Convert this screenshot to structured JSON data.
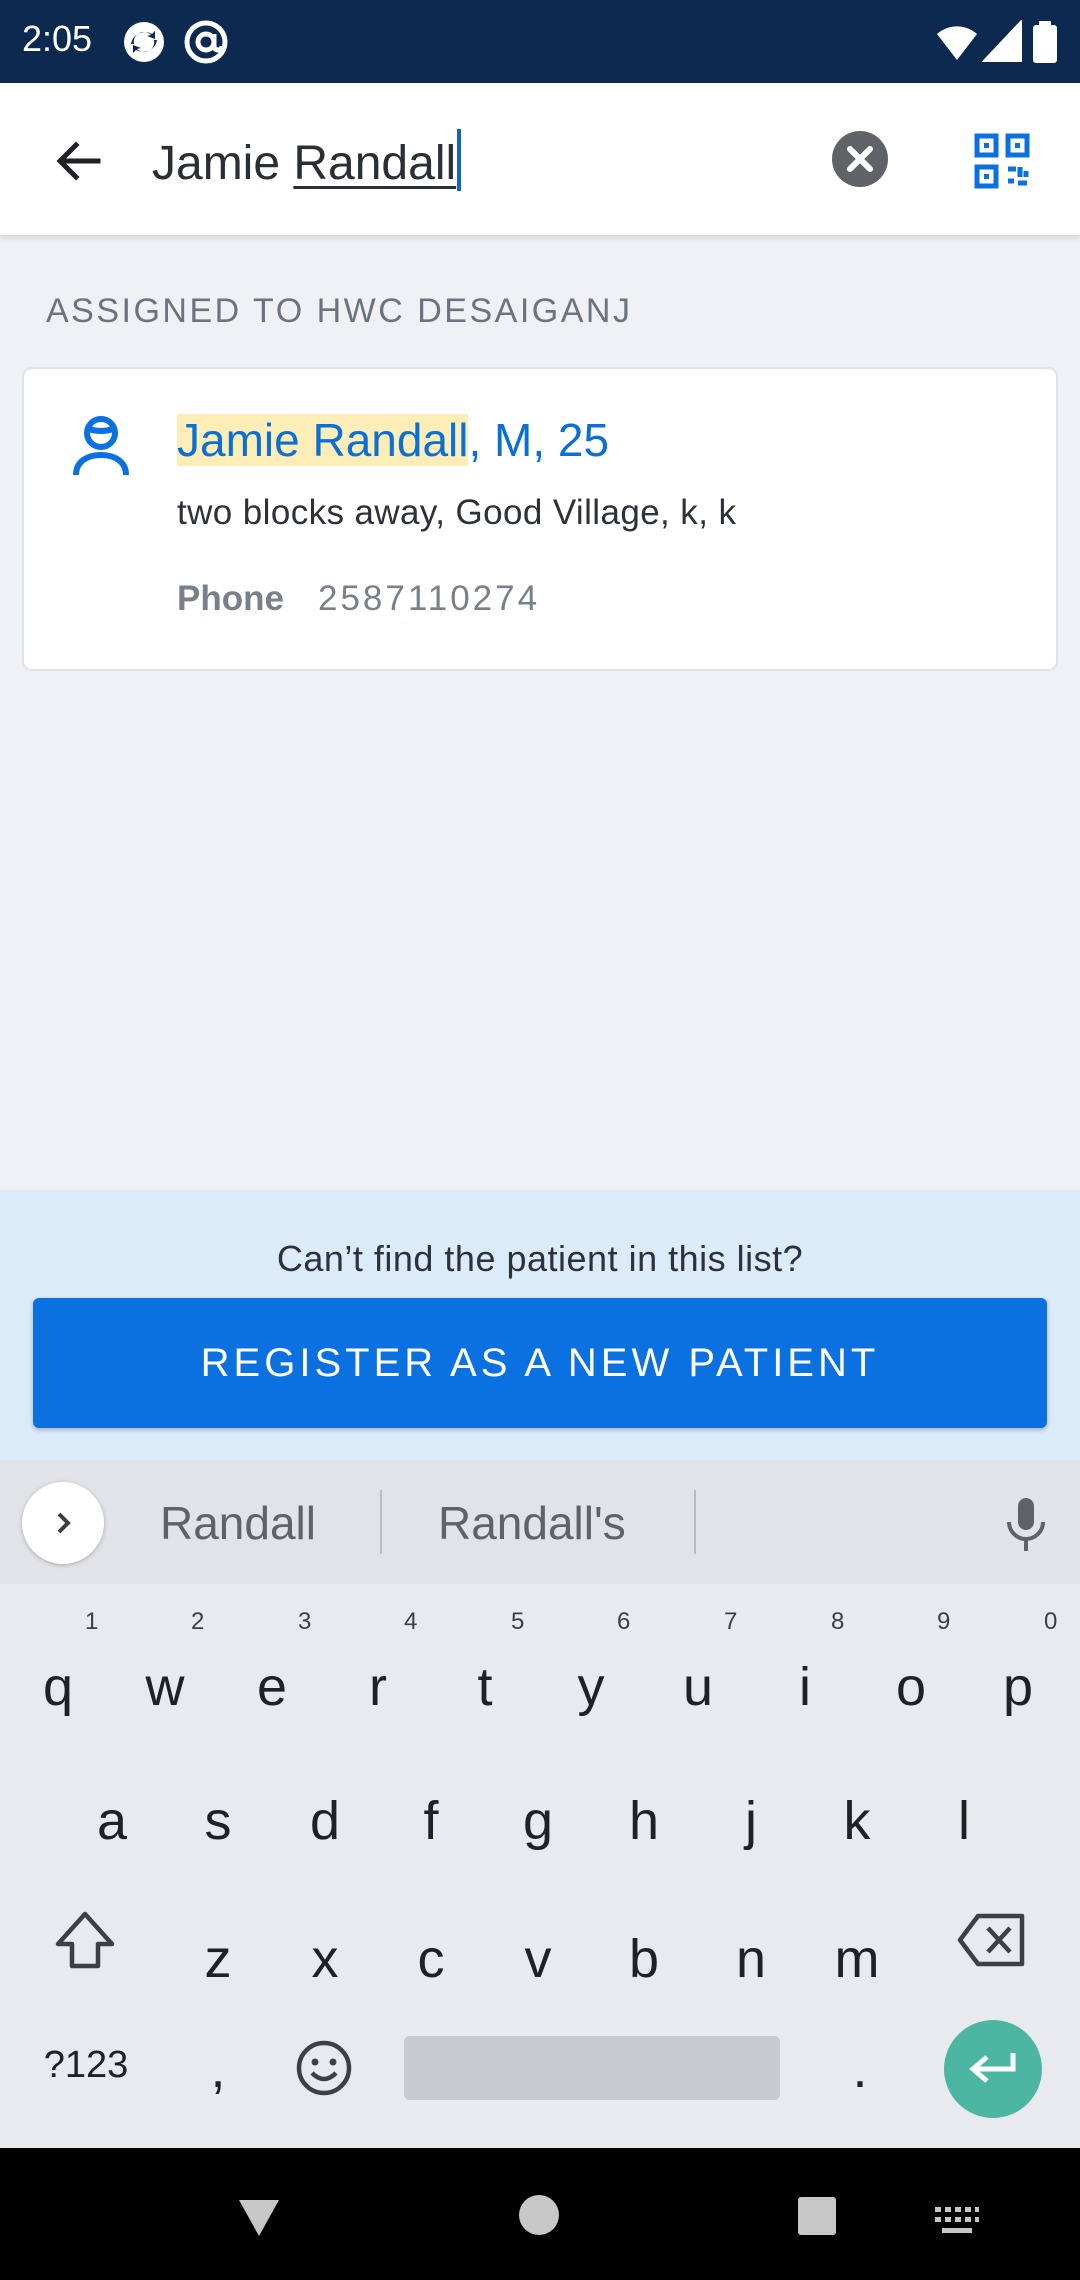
{
  "status_bar": {
    "time": "2:05"
  },
  "search": {
    "query_first": "Jamie ",
    "query_underlined": "Randall"
  },
  "section_header": "ASSIGNED TO HWC DESAIGANJ",
  "patient": {
    "name_highlight": "Jamie Randall",
    "name_rest": ", M, 25",
    "address": "two blocks away, Good Village, k, k",
    "phone_label": "Phone",
    "phone_value": "2587110274"
  },
  "bottom_panel": {
    "prompt": "Can’t find the patient in this list?",
    "register_label": "REGISTER AS A NEW PATIENT"
  },
  "keyboard": {
    "suggestions": [
      "Randall",
      "Randall's"
    ],
    "row1": [
      "q",
      "w",
      "e",
      "r",
      "t",
      "y",
      "u",
      "i",
      "o",
      "p"
    ],
    "row1_hints": [
      "1",
      "2",
      "3",
      "4",
      "5",
      "6",
      "7",
      "8",
      "9",
      "0"
    ],
    "row2": [
      "a",
      "s",
      "d",
      "f",
      "g",
      "h",
      "j",
      "k",
      "l"
    ],
    "row3": [
      "z",
      "x",
      "c",
      "v",
      "b",
      "n",
      "m"
    ],
    "symbols_label": "?123",
    "comma": ",",
    "period": "."
  },
  "colors": {
    "status_bar": "#0c2a50",
    "accent": "#0b70e0",
    "highlight": "#fdeeb8",
    "enter_key": "#4db6a2"
  }
}
